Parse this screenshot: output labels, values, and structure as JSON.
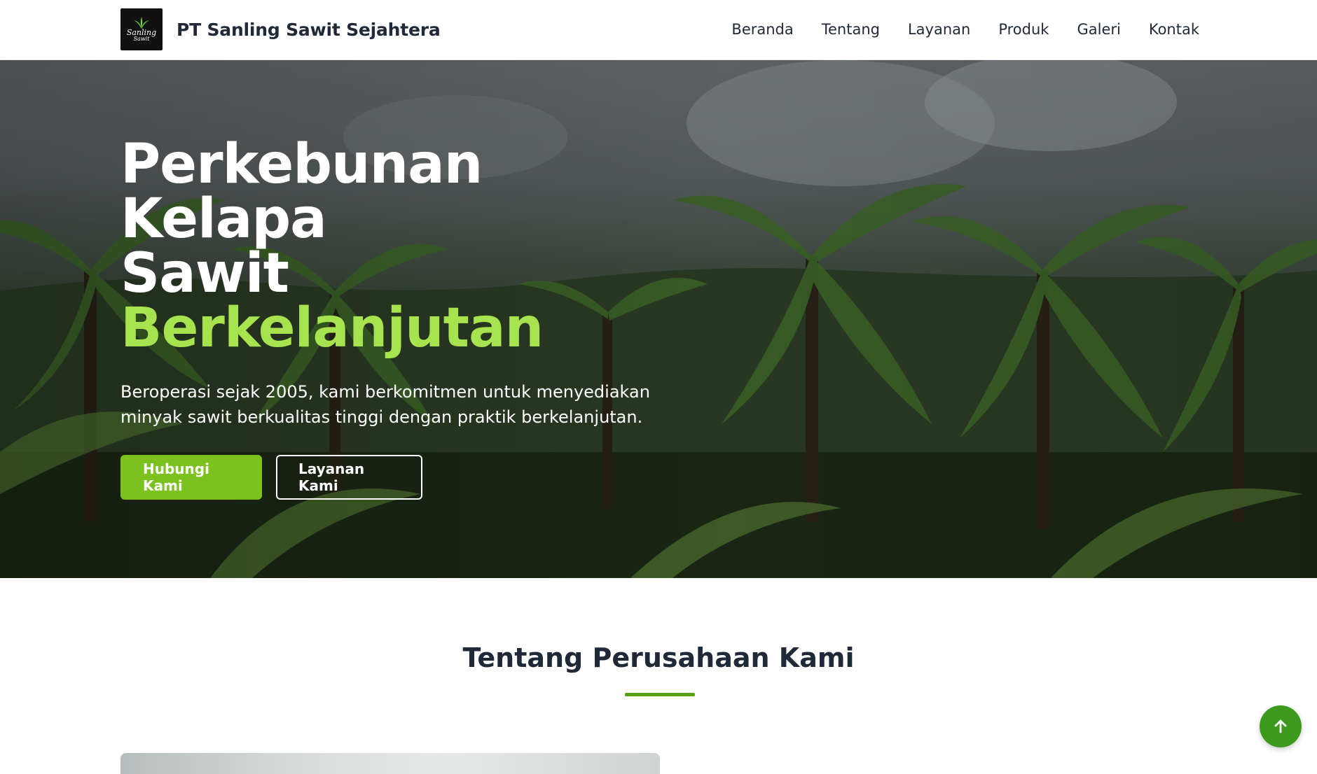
{
  "header": {
    "logo_text_line1": "Sanling",
    "logo_text_line2": "Sawit",
    "brand_name": "PT Sanling Sawit Sejahtera",
    "nav_items": [
      "Beranda",
      "Tentang",
      "Layanan",
      "Produk",
      "Galeri",
      "Kontak"
    ]
  },
  "hero": {
    "title_line1": "Perkebunan Kelapa",
    "title_line2": "Sawit",
    "title_accent": "Berkelanjutan",
    "description": "Beroperasi sejak 2005, kami berkomitmen untuk menyediakan minyak sawit berkualitas tinggi dengan praktik berkelanjutan.",
    "primary_button": "Hubungi Kami",
    "secondary_button": "Layanan Kami"
  },
  "about": {
    "title": "Tentang Perusahaan Kami"
  },
  "icons": {
    "scroll_top": "arrow-up-icon",
    "logo": "palm-leaf-icon"
  },
  "colors": {
    "accent_green": "#a7e24f",
    "button_green": "#7cc21e",
    "underline_green": "#5aa010",
    "scroll_button_green": "#3d9a1c",
    "text_dark": "#1f2937"
  }
}
